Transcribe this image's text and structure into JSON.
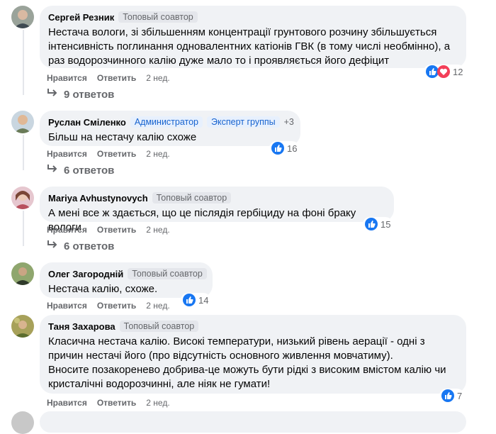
{
  "comments": [
    {
      "author": "Сергей Резник",
      "badges": [
        "Топовый соавтор"
      ],
      "text": [
        "Нестача вологи, зі збільшенням концентрації грунтового розчину збільшується",
        "інтенсивність поглинання одновалентних катіонів ГВК (в тому числі необмінно), а",
        "раз водорозчинного калію дуже мало то і проявляється його дефіцит"
      ],
      "like_label": "Нравится",
      "reply_label": "Ответить",
      "time": "2 нед.",
      "reactions_count": "12",
      "replies_label": "9 ответов"
    },
    {
      "author": "Руслан Сміленко",
      "badges": [
        "Администратор",
        "Эксперт группы"
      ],
      "extra_badges": "+3",
      "text": [
        "Більш на нестачу калію схоже"
      ],
      "like_label": "Нравится",
      "reply_label": "Ответить",
      "time": "2 нед.",
      "reactions_count": "16",
      "replies_label": "6 ответов"
    },
    {
      "author": "Mariya Avhustynovych",
      "badges": [
        "Топовый соавтор"
      ],
      "text": [
        "А мені все ж здається, що це післядія гербіциду на фоні браку вологи"
      ],
      "like_label": "Нравится",
      "reply_label": "Ответить",
      "time": "2 нед.",
      "reactions_count": "15",
      "replies_label": "6 ответов"
    },
    {
      "author": "Олег Загородній",
      "badges": [
        "Топовый соавтор"
      ],
      "text": [
        "Нестача калію, схоже."
      ],
      "like_label": "Нравится",
      "reply_label": "Ответить",
      "time": "2 нед.",
      "reactions_count": "14"
    },
    {
      "author": "Таня Захарова",
      "badges": [
        "Топовый соавтор"
      ],
      "text": [
        "Класична нестача калію. Високі температури, низький рівень аерації - одні з",
        "причин нестачі його (про відсутність основного живлення мовчатиму).",
        "Вносите позакореневo добрива-це можуть бути рідкі з високим вмістом калію чи",
        "кристалічні водорозчинні, але ніяк не гумати!"
      ],
      "like_label": "Нравится",
      "reply_label": "Ответить",
      "time": "2 нед.",
      "reactions_count": "7"
    }
  ],
  "colors": {
    "like_blue": "#1877f2",
    "love_red": "#f33e58",
    "bubble": "#f0f2f5",
    "muted": "#65676b"
  },
  "icons": {
    "like": "like-icon",
    "love": "love-icon",
    "reply_arrow": "reply-arrow-icon"
  }
}
